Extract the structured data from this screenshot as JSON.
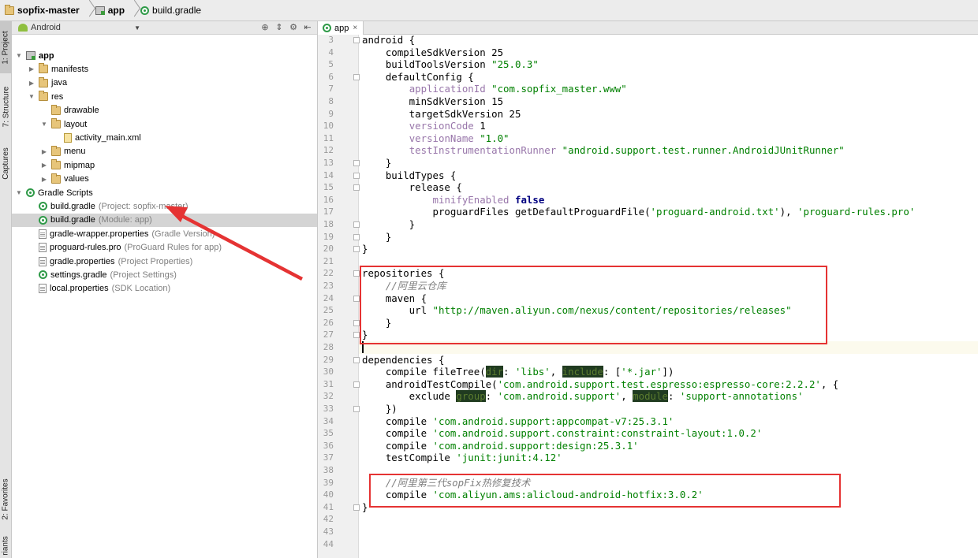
{
  "breadcrumb": [
    {
      "label": "sopfix-master",
      "icon": "folder-icon"
    },
    {
      "label": "app",
      "icon": "module-icon"
    },
    {
      "label": "build.gradle",
      "icon": "gradle-icon"
    }
  ],
  "toolwindows": {
    "project": "1: Project",
    "structure": "7: Structure",
    "captures": "Captures",
    "favorites": "2: Favorites",
    "variants": "riants"
  },
  "panel": {
    "view_mode": "Android"
  },
  "tree": [
    {
      "label": "app",
      "hint": "",
      "icon": "module",
      "arrow": "▼",
      "indent": 0,
      "bold": true
    },
    {
      "label": "manifests",
      "hint": "",
      "icon": "folder",
      "arrow": "▶",
      "indent": 1
    },
    {
      "label": "java",
      "hint": "",
      "icon": "folder",
      "arrow": "▶",
      "indent": 1
    },
    {
      "label": "res",
      "hint": "",
      "icon": "folder",
      "arrow": "▼",
      "indent": 1
    },
    {
      "label": "drawable",
      "hint": "",
      "icon": "folder",
      "arrow": "",
      "indent": 2
    },
    {
      "label": "layout",
      "hint": "",
      "icon": "folder",
      "arrow": "▼",
      "indent": 2
    },
    {
      "label": "activity_main.xml",
      "hint": "",
      "icon": "xml",
      "arrow": "",
      "indent": 3
    },
    {
      "label": "menu",
      "hint": "",
      "icon": "folder",
      "arrow": "▶",
      "indent": 2
    },
    {
      "label": "mipmap",
      "hint": "",
      "icon": "folder",
      "arrow": "▶",
      "indent": 2
    },
    {
      "label": "values",
      "hint": "",
      "icon": "folder",
      "arrow": "▶",
      "indent": 2
    },
    {
      "label": "Gradle Scripts",
      "hint": "",
      "icon": "gradle",
      "arrow": "▼",
      "indent": 0
    },
    {
      "label": "build.gradle",
      "hint": "(Project: sopfix-master)",
      "icon": "gradle",
      "arrow": "",
      "indent": 1
    },
    {
      "label": "build.gradle",
      "hint": "(Module: app)",
      "icon": "gradle",
      "arrow": "",
      "indent": 1,
      "selected": true
    },
    {
      "label": "gradle-wrapper.properties",
      "hint": "(Gradle Version)",
      "icon": "file",
      "arrow": "",
      "indent": 1
    },
    {
      "label": "proguard-rules.pro",
      "hint": "(ProGuard Rules for app)",
      "icon": "file",
      "arrow": "",
      "indent": 1
    },
    {
      "label": "gradle.properties",
      "hint": "(Project Properties)",
      "icon": "file",
      "arrow": "",
      "indent": 1
    },
    {
      "label": "settings.gradle",
      "hint": "(Project Settings)",
      "icon": "gradle",
      "arrow": "",
      "indent": 1
    },
    {
      "label": "local.properties",
      "hint": "(SDK Location)",
      "icon": "file",
      "arrow": "",
      "indent": 1
    }
  ],
  "editor": {
    "tab_label": "app",
    "tab_close": "×",
    "lines": [
      {
        "n": "3",
        "tokens": [
          [
            "g",
            "android {"
          ]
        ]
      },
      {
        "n": "4",
        "tokens": [
          [
            "g",
            "    compileSdkVersion 25"
          ]
        ]
      },
      {
        "n": "5",
        "tokens": [
          [
            "g",
            "    buildToolsVersion "
          ],
          [
            "sg",
            "\"25.0.3\""
          ]
        ]
      },
      {
        "n": "6",
        "tokens": [
          [
            "g",
            "    defaultConfig {"
          ]
        ]
      },
      {
        "n": "7",
        "tokens": [
          [
            "g",
            "        "
          ],
          [
            "pp",
            "applicationId"
          ],
          [
            "g",
            " "
          ],
          [
            "sg",
            "\"com.sopfix_master.www\""
          ]
        ]
      },
      {
        "n": "8",
        "tokens": [
          [
            "g",
            "        minSdkVersion 15"
          ]
        ]
      },
      {
        "n": "9",
        "tokens": [
          [
            "g",
            "        targetSdkVersion 25"
          ]
        ]
      },
      {
        "n": "10",
        "tokens": [
          [
            "g",
            "        "
          ],
          [
            "pp",
            "versionCode"
          ],
          [
            "g",
            " 1"
          ]
        ]
      },
      {
        "n": "11",
        "tokens": [
          [
            "g",
            "        "
          ],
          [
            "pp",
            "versionName"
          ],
          [
            "g",
            " "
          ],
          [
            "sg",
            "\"1.0\""
          ]
        ]
      },
      {
        "n": "12",
        "tokens": [
          [
            "g",
            "        "
          ],
          [
            "pp",
            "testInstrumentationRunner"
          ],
          [
            "g",
            " "
          ],
          [
            "sg",
            "\"android.support.test.runner.AndroidJUnitRunner\""
          ]
        ]
      },
      {
        "n": "13",
        "tokens": [
          [
            "g",
            "    }"
          ]
        ]
      },
      {
        "n": "14",
        "tokens": [
          [
            "g",
            "    buildTypes {"
          ]
        ]
      },
      {
        "n": "15",
        "tokens": [
          [
            "g",
            "        release {"
          ]
        ]
      },
      {
        "n": "16",
        "tokens": [
          [
            "g",
            "            "
          ],
          [
            "pp",
            "minifyEnabled"
          ],
          [
            "g",
            " "
          ],
          [
            "k",
            "false"
          ]
        ]
      },
      {
        "n": "17",
        "tokens": [
          [
            "g",
            "            proguardFiles getDefaultProguardFile("
          ],
          [
            "sg",
            "'proguard-android.txt'"
          ],
          [
            "g",
            "), "
          ],
          [
            "sg",
            "'proguard-rules.pro'"
          ]
        ]
      },
      {
        "n": "18",
        "tokens": [
          [
            "g",
            "        }"
          ]
        ]
      },
      {
        "n": "19",
        "tokens": [
          [
            "g",
            "    }"
          ]
        ]
      },
      {
        "n": "20",
        "tokens": [
          [
            "g",
            "}"
          ]
        ]
      },
      {
        "n": "21",
        "tokens": [
          [
            "g",
            ""
          ]
        ]
      },
      {
        "n": "22",
        "tokens": [
          [
            "g",
            "repositories {"
          ]
        ]
      },
      {
        "n": "23",
        "tokens": [
          [
            "c",
            "    //阿里云仓库"
          ]
        ]
      },
      {
        "n": "24",
        "tokens": [
          [
            "g",
            "    maven {"
          ]
        ]
      },
      {
        "n": "25",
        "tokens": [
          [
            "g",
            "        url "
          ],
          [
            "sg",
            "\"http://maven.aliyun.com/nexus/content/repositories/releases\""
          ]
        ]
      },
      {
        "n": "26",
        "tokens": [
          [
            "g",
            "    }"
          ]
        ]
      },
      {
        "n": "27",
        "tokens": [
          [
            "g",
            "}"
          ]
        ]
      },
      {
        "n": "28",
        "tokens": [
          [
            "g",
            ""
          ]
        ]
      },
      {
        "n": "29",
        "tokens": [
          [
            "g",
            "dependencies {"
          ]
        ]
      },
      {
        "n": "30",
        "tokens": [
          [
            "g",
            "    compile fileTree("
          ],
          [
            "hl",
            "dir"
          ],
          [
            "g",
            ": "
          ],
          [
            "sg",
            "'libs'"
          ],
          [
            "g",
            ", "
          ],
          [
            "hl",
            "include"
          ],
          [
            "g",
            ": ["
          ],
          [
            "sg",
            "'*.jar'"
          ],
          [
            "g",
            "])"
          ]
        ]
      },
      {
        "n": "31",
        "tokens": [
          [
            "g",
            "    androidTestCompile("
          ],
          [
            "sg",
            "'com.android.support.test.espresso:espresso-core:2.2.2'"
          ],
          [
            "g",
            ", {"
          ]
        ]
      },
      {
        "n": "32",
        "tokens": [
          [
            "g",
            "        exclude "
          ],
          [
            "hl",
            "group"
          ],
          [
            "g",
            ": "
          ],
          [
            "sg",
            "'com.android.support'"
          ],
          [
            "g",
            ", "
          ],
          [
            "hl",
            "module"
          ],
          [
            "g",
            ": "
          ],
          [
            "sg",
            "'support-annotations'"
          ]
        ]
      },
      {
        "n": "33",
        "tokens": [
          [
            "g",
            "    })"
          ]
        ]
      },
      {
        "n": "34",
        "tokens": [
          [
            "g",
            "    compile "
          ],
          [
            "sg",
            "'com.android.support:appcompat-v7:25.3.1'"
          ]
        ]
      },
      {
        "n": "35",
        "tokens": [
          [
            "g",
            "    compile "
          ],
          [
            "sg",
            "'com.android.support.constraint:constraint-layout:1.0.2'"
          ]
        ]
      },
      {
        "n": "36",
        "tokens": [
          [
            "g",
            "    compile "
          ],
          [
            "sg",
            "'com.android.support:design:25.3.1'"
          ]
        ]
      },
      {
        "n": "37",
        "tokens": [
          [
            "g",
            "    testCompile "
          ],
          [
            "sg",
            "'junit:junit:4.12'"
          ]
        ]
      },
      {
        "n": "38",
        "tokens": [
          [
            "g",
            ""
          ]
        ]
      },
      {
        "n": "39",
        "tokens": [
          [
            "c",
            "    //阿里第三代sopFix热修复技术"
          ]
        ]
      },
      {
        "n": "40",
        "tokens": [
          [
            "g",
            "    compile "
          ],
          [
            "sg",
            "'com.aliyun.ams:alicloud-android-hotfix:3.0.2'"
          ]
        ]
      },
      {
        "n": "41",
        "tokens": [
          [
            "g",
            "}"
          ]
        ]
      },
      {
        "n": "42",
        "tokens": [
          [
            "g",
            ""
          ]
        ]
      },
      {
        "n": "43",
        "tokens": [
          [
            "g",
            ""
          ]
        ]
      },
      {
        "n": "44",
        "tokens": [
          [
            "g",
            ""
          ]
        ]
      }
    ]
  },
  "colors": {
    "annotation": "#e53333",
    "string": "#008000",
    "property": "#9876aa",
    "comment": "#808080"
  }
}
